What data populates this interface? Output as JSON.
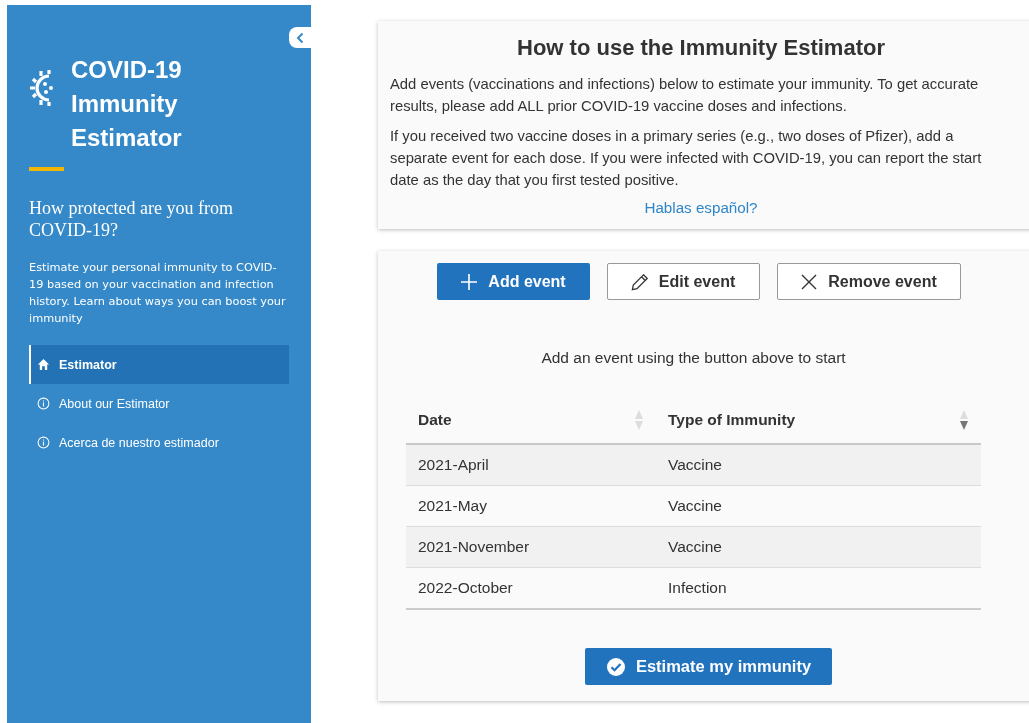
{
  "sidebar": {
    "title_lines": [
      "COVID-19",
      "Immunity",
      "Estimator"
    ],
    "subtitle": "How protected are you from COVID-19?",
    "description": "Estimate your personal immunity to COVID-19 based on your vaccination and infection history. Learn about ways you can boost your immunity",
    "nav": [
      {
        "label": "Estimator",
        "selected": true
      },
      {
        "label": "About our Estimator",
        "selected": false
      },
      {
        "label": "Acerca de nuestro estimador",
        "selected": false
      }
    ]
  },
  "instructions": {
    "title": "How to use the Immunity Estimator",
    "paragraphs": [
      "Add events (vaccinations and infections) below to estimate your immunity. To get accurate results, please add ALL prior COVID-19 vaccine doses and infections.",
      "If you received two vaccine doses in a primary series (e.g., two doses of Pfizer), add a separate event for each dose. If you were infected with COVID-19, you can report the start date as the day that you first tested positive."
    ],
    "link": "Hablas español?"
  },
  "actions": [
    {
      "label": "Add event",
      "kind": "primary"
    },
    {
      "label": "Edit event",
      "kind": "outline"
    },
    {
      "label": "Remove event",
      "kind": "outline"
    }
  ],
  "hint": "Add an event using the button above to start",
  "table": {
    "columns": [
      {
        "label": "Date",
        "sorted_descending": false
      },
      {
        "label": "Type of Immunity",
        "sorted_descending": true
      }
    ],
    "rows": [
      [
        "2021-April",
        "Vaccine"
      ],
      [
        "2021-May",
        "Vaccine"
      ],
      [
        "2021-November",
        "Vaccine"
      ],
      [
        "2022-October",
        "Infection"
      ]
    ]
  },
  "submit": {
    "label": "Estimate my immunity"
  }
}
